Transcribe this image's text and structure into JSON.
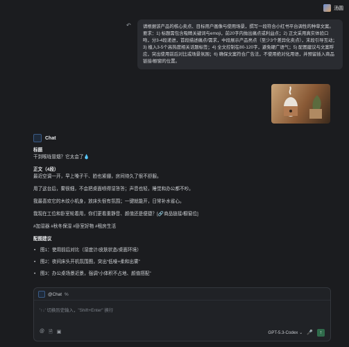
{
  "topbar": {
    "username": "汤圆"
  },
  "user_message": {
    "text": "请根据该产品的核心卖点、目标用户画像与使用场景，撰写一段符合小红书平台调性的种草文案。要求：1) 标题需包含吸睛关键词与emoji，前20字内抛出痛点或利益点；2) 正文采用真实体验口吻，分3-4段递进，首段描述痛点/需求，中段展示产品亮点（至少3个差异化卖点），末段引导互动；3) 植入3-5个高热度相关话题标签；4) 全文控制在80-120字，避免硬广语气；5) 配图建议与文案呼应，突出使用前后对比或场景氛围；6) 确保文案符合广告法，不使用绝对化用语，并预留插入商品链接/橱窗的位置。"
  },
  "chat": {
    "title": "Chat",
    "label_title": "标题",
    "title_text": "干到喉咙冒烟？它太会了💧",
    "label_body": "正文（4段）",
    "p1": "最近空调一开，早上嗓子干、脸也紧绷，房间待久了很不舒服。",
    "p2": "用了这台后，雾很细，不会把桌面喷得湿答答；声音也轻，睡觉和办公都不吵。",
    "p3": "我最喜欢它的木纹小机身，放床头很有氛围；一键就能开，日常补水省心。",
    "p4": "我现在工位和卧室轮着用，你们更看重静音、颜值还是便捷？[🔗商品链接/橱窗位]",
    "tags": "#加湿器 #秋冬保湿 #卧室好物 #租房生活",
    "label_images": "配图建议",
    "bullets": [
      "图1：使用前后对比（湿度计/皮肤状态/桌面环境）",
      "图2：夜间床头开机氛围图，突出“低噪+柔和出雾”",
      "图3：办公桌场景近景，强调“小体积不占地、颜值搭配”"
    ]
  },
  "composer": {
    "tag": "@Chat",
    "tag_symbol": "%",
    "placeholder": "'↑↓' 切换历史输入，\"Shift+Enter\" 换行",
    "model": "GPT-5.3-Codex ⌄"
  }
}
